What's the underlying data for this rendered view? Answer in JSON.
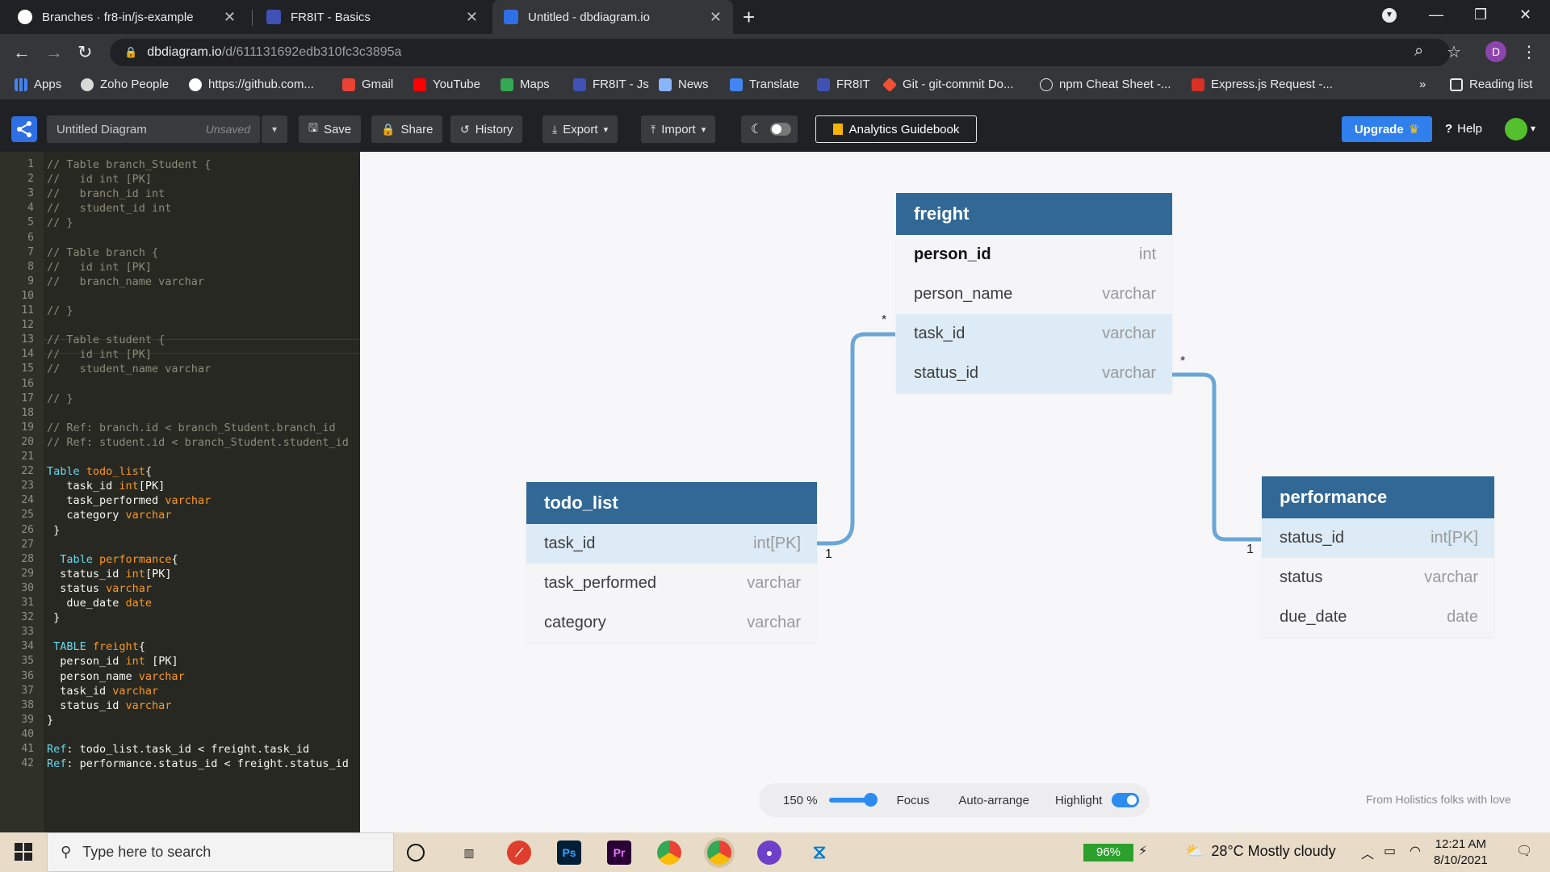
{
  "browser": {
    "tabs": [
      {
        "title": "Branches · fr8-in/js-example",
        "favicon": "github-icon"
      },
      {
        "title": "FR8IT - Basics",
        "favicon": "fr8it-icon"
      },
      {
        "title": "Untitled - dbdiagram.io",
        "favicon": "dbdiagram-icon"
      }
    ],
    "url_host": "dbdiagram.io",
    "url_path": "/d/611131692edb310fc3c3895a",
    "profile_letter": "D",
    "bookmarks": [
      "Apps",
      "Zoho People",
      "https://github.com...",
      "Gmail",
      "YouTube",
      "Maps",
      "FR8IT - Js",
      "News",
      "Translate",
      "FR8IT",
      "Git - git-commit Do...",
      "npm Cheat Sheet -...",
      "Express.js Request -..."
    ],
    "bookmarks_overflow": "»",
    "reading_list": "Reading list"
  },
  "app": {
    "diagram_name": "Untitled Diagram",
    "unsaved": "Unsaved",
    "buttons": {
      "save": "Save",
      "share": "Share",
      "history": "History",
      "export": "Export",
      "import": "Import",
      "guidebook": "Analytics Guidebook",
      "upgrade": "Upgrade",
      "help": "Help"
    }
  },
  "editor": {
    "lines": [
      "// Table branch_Student {",
      "//   id int [PK]",
      "//   branch_id int",
      "//   student_id int",
      "// }",
      "",
      "// Table branch {",
      "//   id int [PK]",
      "//   branch_name varchar",
      "",
      "// }",
      "",
      "// Table student {",
      "//   id int [PK]",
      "//   student_name varchar",
      "",
      "// }",
      "",
      "// Ref: branch.id < branch_Student.branch_id",
      "// Ref: student.id < branch_Student.student_id",
      "",
      "Table todo_list{",
      "   task_id int[PK]",
      "   task_performed varchar",
      "   category varchar",
      " }",
      "",
      "  Table performance{",
      "  status_id int[PK]",
      "  status varchar",
      "   due_date date",
      " }",
      "",
      " TABLE freight{",
      "  person_id int [PK]",
      "  person_name varchar",
      "  task_id varchar",
      "  status_id varchar",
      "}",
      "",
      "Ref: todo_list.task_id < freight.task_id",
      "Ref: performance.status_id < freight.status_id"
    ]
  },
  "diagram": {
    "tables": {
      "freight": {
        "name": "freight",
        "rows": [
          {
            "name": "person_id",
            "type": "int"
          },
          {
            "name": "person_name",
            "type": "varchar"
          },
          {
            "name": "task_id",
            "type": "varchar"
          },
          {
            "name": "status_id",
            "type": "varchar"
          }
        ]
      },
      "todo_list": {
        "name": "todo_list",
        "rows": [
          {
            "name": "task_id",
            "type": "int[PK]"
          },
          {
            "name": "task_performed",
            "type": "varchar"
          },
          {
            "name": "category",
            "type": "varchar"
          }
        ]
      },
      "performance": {
        "name": "performance",
        "rows": [
          {
            "name": "status_id",
            "type": "int[PK]"
          },
          {
            "name": "status",
            "type": "varchar"
          },
          {
            "name": "due_date",
            "type": "date"
          }
        ]
      }
    },
    "cardinality": {
      "many": "*",
      "one": "1"
    },
    "relation_color": "#6ba6d8",
    "header_color": "#316896"
  },
  "controls": {
    "zoom": "150 %",
    "focus": "Focus",
    "auto_arrange": "Auto-arrange",
    "highlight": "Highlight",
    "credit": "From Holistics folks with love"
  },
  "taskbar": {
    "search_placeholder": "Type here to search",
    "battery": "96%",
    "weather": "28°C  Mostly cloudy",
    "time": "12:21 AM",
    "date": "8/10/2021"
  }
}
